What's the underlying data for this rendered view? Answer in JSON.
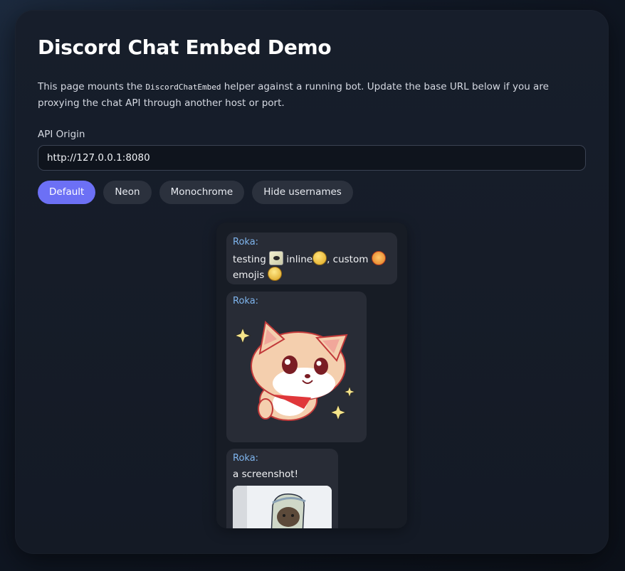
{
  "page": {
    "title": "Discord Chat Embed Demo",
    "description_before": "This page mounts the ",
    "description_code": "DiscordChatEmbed",
    "description_after": " helper against a running bot. Update the base URL below if you are proxying the chat API through another host or port."
  },
  "api": {
    "label": "API Origin",
    "value": "http://127.0.0.1:8080"
  },
  "themes": [
    {
      "label": "Default",
      "active": true
    },
    {
      "label": "Neon",
      "active": false
    },
    {
      "label": "Monochrome",
      "active": false
    },
    {
      "label": "Hide usernames",
      "active": false
    }
  ],
  "messages": [
    {
      "author": "Roka:",
      "text_1": "testing ",
      "text_2": " inline",
      "text_3": ", custom ",
      "text_4": "emojis ",
      "emojis": [
        "pepe-emoji",
        "dizzy-face-emoji",
        "angry-face-emoji",
        "pleading-face-emoji"
      ]
    },
    {
      "author": "Roka:",
      "sticker": "shiba-sticker"
    },
    {
      "author": "Roka:",
      "text": "a screenshot!",
      "attachment": "screenshot-image"
    }
  ],
  "colors": {
    "accent": "#6c70f5",
    "author": "#7fb5ee",
    "bubble": "#282c36"
  }
}
